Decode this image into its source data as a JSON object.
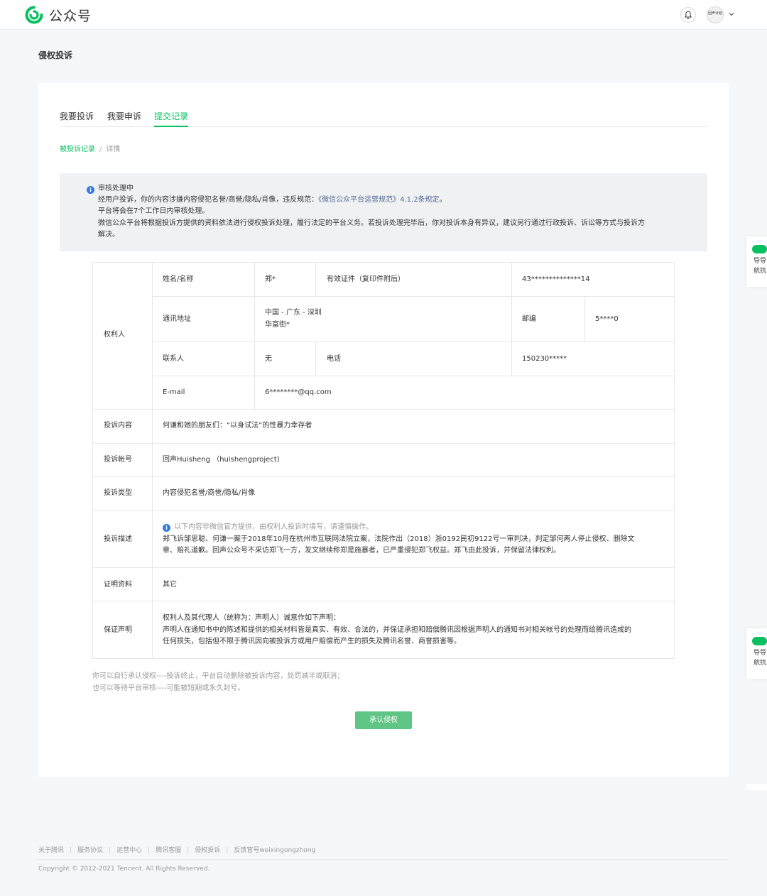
{
  "header": {
    "logo_text": "公众号",
    "avatar_text": "回声计划",
    "brand_color": "#07c160"
  },
  "page": {
    "title": "侵权投诉"
  },
  "tabs": [
    {
      "label": "我要投诉",
      "active": false
    },
    {
      "label": "我要申诉",
      "active": false
    },
    {
      "label": "提交记录",
      "active": true
    }
  ],
  "breadcrumb": {
    "link": "被投诉记录",
    "separator": "/",
    "current": "详情"
  },
  "notice": {
    "status": "审核处理中",
    "line1_prefix": "经用户投诉，你的内容涉嫌内容侵犯名誉/商誉/隐私/肖像，违反规范：",
    "line1_link": "《微信公众平台运营规范》4.1.2条规定",
    "line1_suffix": "。",
    "line2": "平台将会在7个工作日内审核处理。",
    "line3": "微信公众平台将根据投诉方提供的资料依法进行侵权投诉处理，履行法定的平台义务。若投诉处理完毕后，你对投诉本身有异议，建议另行通过行政投诉、诉讼等方式与投诉方",
    "line4": "解决。"
  },
  "table": {
    "rights_holder": {
      "label": "权利人",
      "name_label": "姓名/名称",
      "name_value": "郑*",
      "id_label": "有效证件（复印件附后）",
      "id_value": "43**************14",
      "address_label": "通讯地址",
      "address_line1": "中国 - 广东 - 深圳",
      "address_line2": "华富街*",
      "postcode_label": "邮编",
      "postcode_value": "5****0",
      "contact_label": "联系人",
      "contact_value": "无",
      "phone_label": "电话",
      "phone_value": "150230*****",
      "email_label": "E-mail",
      "email_value": "6********@qq.com"
    },
    "content": {
      "label": "投诉内容",
      "value": "何谦和她的朋友们：“以身试法”的性暴力幸存者"
    },
    "account": {
      "label": "投诉帐号",
      "value": "回声Huisheng （huishengproject)"
    },
    "type": {
      "label": "投诉类型",
      "value": "内容侵犯名誉/商誉/隐私/肖像"
    },
    "description": {
      "label": "投诉描述",
      "hint": "以下内容非微信官方提供，由权利人投诉时填写，请谨慎操作。",
      "line1": "郑飞诉邹思聪、何谦一案于2018年10月在杭州市互联网法院立案，法院作出（2018）浙0192民初9122号一审判决，判定邹何两人停止侵权、删除文",
      "line2": "章、赔礼道歉。回声公众号不采访郑飞一方，发文继续称郑是施暴者，已严重侵犯郑飞权益。郑飞由此投诉，并保留法律权利。"
    },
    "evidence": {
      "label": "证明资料",
      "value": "其它"
    },
    "declaration": {
      "label": "保证声明",
      "line1": "权利人及其代理人（统称为：声明人）诚意作如下声明：",
      "line2": "声明人在通知书中的陈述和提供的相关材料皆是真实、有效、合法的，并保证承担和赔偿腾讯因根据声明人的通知书对相关帐号的处理而给腾讯造成的",
      "line3": "任何损失，包括但不限于腾讯因向被投诉方或用户赔偿而产生的损失及腾讯名誉、商誉损害等。"
    }
  },
  "tips": {
    "line1": "你可以自行承认侵权----投诉终止，平台自动删除被投诉内容，处罚减半或取消；",
    "line2": "也可以等待平台审核----可能被短期或永久封号。"
  },
  "action": {
    "label": "承认侵权"
  },
  "side_widgets": [
    {
      "line1": "导导",
      "line2": "航抗"
    },
    {
      "line1": "导导",
      "line2": "航抗"
    }
  ],
  "footer": {
    "links": [
      "关于腾讯",
      "服务协议",
      "运营中心",
      "腾讯客服",
      "侵权投诉",
      "反馈官号weixingongzhong"
    ],
    "separator": "|",
    "copyright": "Copyright © 2012-2021 Tencent. All Rights Reserved."
  }
}
